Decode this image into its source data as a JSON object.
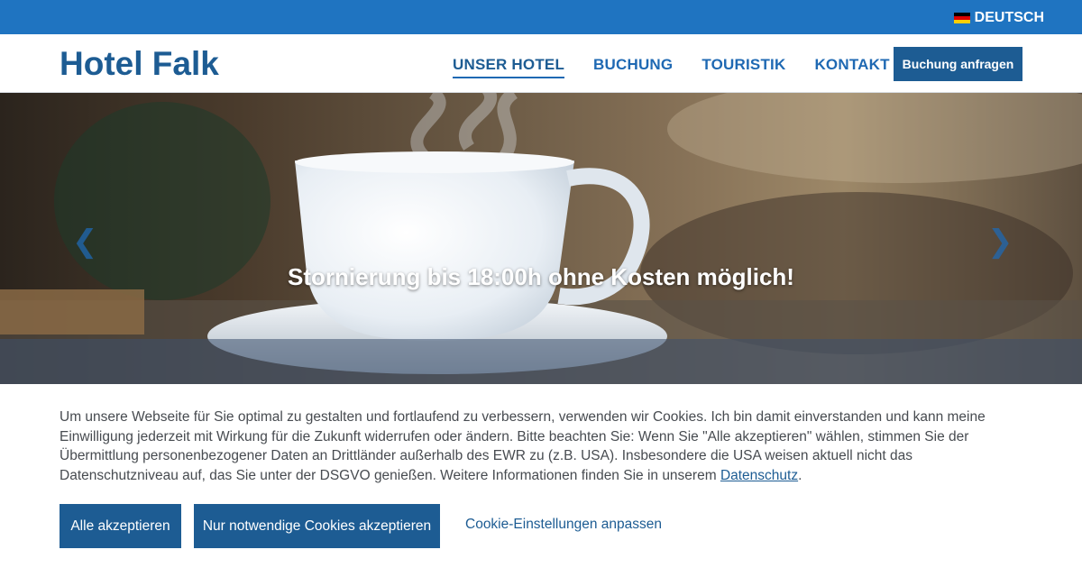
{
  "topbar": {
    "language_label": "DEUTSCH",
    "flag_colors": [
      "#000000",
      "#dd0000",
      "#ffce00"
    ]
  },
  "header": {
    "logo": "Hotel Falk",
    "nav": [
      {
        "label": "UNSER HOTEL",
        "active": true
      },
      {
        "label": "BUCHUNG",
        "active": false
      },
      {
        "label": "TOURISTIK",
        "active": false
      },
      {
        "label": "KONTAKT",
        "active": false
      }
    ],
    "cta_label": "Buchung anfragen"
  },
  "hero": {
    "caption": "Stornierung bis 18:00h ohne Kosten möglich!",
    "prev_icon": "chevron-left-icon",
    "next_icon": "chevron-right-icon"
  },
  "cookie": {
    "text_before_link": "Um unsere Webseite für Sie optimal zu gestalten und fortlaufend zu verbessern, verwenden wir Cookies. Ich bin damit einverstanden und kann meine Einwilligung jederzeit mit Wirkung für die Zukunft widerrufen oder ändern. Bitte beachten Sie: Wenn Sie \"Alle akzeptieren\" wählen, stimmen Sie der Übermittlung personenbezogener Daten an Drittländer außerhalb des EWR zu (z.B. USA). Insbesondere die USA weisen aktuell nicht das Datenschutzniveau auf, das Sie unter der DSGVO genießen. Weitere Informationen finden Sie in unserem ",
    "link_label": "Datenschutz",
    "text_after_link": ".",
    "accept_all_label": "Alle akzeptieren",
    "necessary_only_label": "Nur notwendige Cookies akzeptieren",
    "settings_label": "Cookie-Einstellungen anpassen"
  },
  "colors": {
    "topbar": "#1f74c1",
    "brand": "#1d5c93",
    "nav_link": "#1f69b3",
    "body_text": "#474b50"
  }
}
